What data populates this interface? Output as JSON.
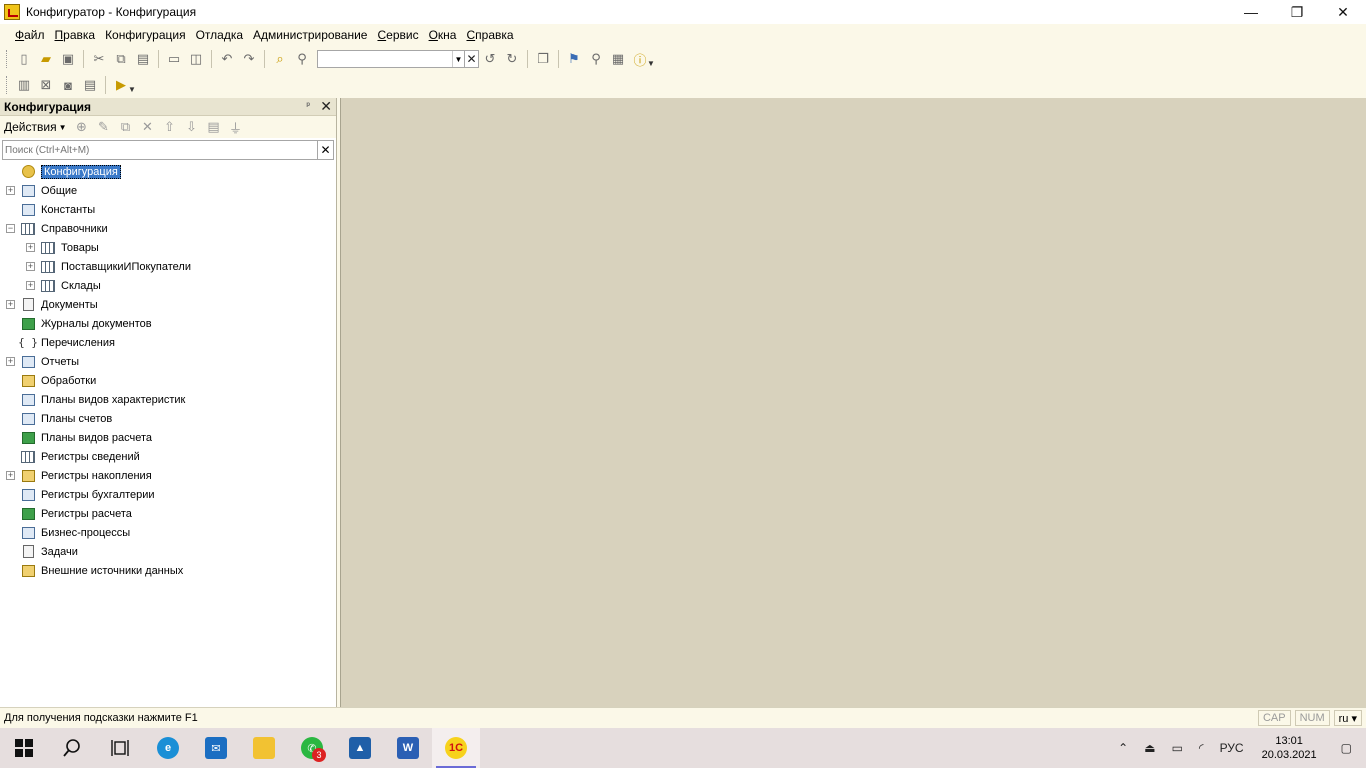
{
  "window": {
    "title": "Конфигуратор - Конфигурация",
    "minimize": "—",
    "maximize": "❐",
    "close": "✕"
  },
  "menu": [
    "Файл",
    "Правка",
    "Конфигурация",
    "Отладка",
    "Администрирование",
    "Сервис",
    "Окна",
    "Справка"
  ],
  "panel": {
    "title": "Конфигурация",
    "pin": "ᵖ",
    "close": "✕",
    "actions_label": "Действия",
    "search_placeholder": "Поиск (Ctrl+Alt+M)",
    "search_clear": "✕"
  },
  "tree": [
    {
      "label": "Конфигурация",
      "level": 0,
      "expander": "none",
      "icon": "ic-root",
      "root": true
    },
    {
      "label": "Общие",
      "level": 0,
      "expander": "+",
      "icon": "ic-generic"
    },
    {
      "label": "Константы",
      "level": 0,
      "expander": "none",
      "icon": "ic-generic"
    },
    {
      "label": "Справочники",
      "level": 0,
      "expander": "−",
      "icon": "ic-table"
    },
    {
      "label": "Товары",
      "level": 1,
      "expander": "+",
      "icon": "ic-table"
    },
    {
      "label": "ПоставщикиИПокупатели",
      "level": 1,
      "expander": "+",
      "icon": "ic-table"
    },
    {
      "label": "Склады",
      "level": 1,
      "expander": "+",
      "icon": "ic-table"
    },
    {
      "label": "Документы",
      "level": 0,
      "expander": "+",
      "icon": "ic-doc"
    },
    {
      "label": "Журналы документов",
      "level": 0,
      "expander": "none",
      "icon": "ic-green"
    },
    {
      "label": "Перечисления",
      "level": 0,
      "expander": "none",
      "icon": "ic-brace"
    },
    {
      "label": "Отчеты",
      "level": 0,
      "expander": "+",
      "icon": "ic-generic"
    },
    {
      "label": "Обработки",
      "level": 0,
      "expander": "none",
      "icon": "ic-gold"
    },
    {
      "label": "Планы видов характеристик",
      "level": 0,
      "expander": "none",
      "icon": "ic-generic"
    },
    {
      "label": "Планы счетов",
      "level": 0,
      "expander": "none",
      "icon": "ic-generic"
    },
    {
      "label": "Планы видов расчета",
      "level": 0,
      "expander": "none",
      "icon": "ic-green"
    },
    {
      "label": "Регистры сведений",
      "level": 0,
      "expander": "none",
      "icon": "ic-table"
    },
    {
      "label": "Регистры накопления",
      "level": 0,
      "expander": "+",
      "icon": "ic-gold"
    },
    {
      "label": "Регистры бухгалтерии",
      "level": 0,
      "expander": "none",
      "icon": "ic-generic"
    },
    {
      "label": "Регистры расчета",
      "level": 0,
      "expander": "none",
      "icon": "ic-green"
    },
    {
      "label": "Бизнес-процессы",
      "level": 0,
      "expander": "none",
      "icon": "ic-generic"
    },
    {
      "label": "Задачи",
      "level": 0,
      "expander": "none",
      "icon": "ic-doc"
    },
    {
      "label": "Внешние источники данных",
      "level": 0,
      "expander": "none",
      "icon": "ic-gold"
    }
  ],
  "status": {
    "hint": "Для получения подсказки нажмите F1",
    "cap": "CAP",
    "num": "NUM",
    "lang": "ru ▾"
  },
  "taskbar": {
    "badge": "3",
    "input_lang": "РУС",
    "time": "13:01",
    "date": "20.03.2021"
  }
}
